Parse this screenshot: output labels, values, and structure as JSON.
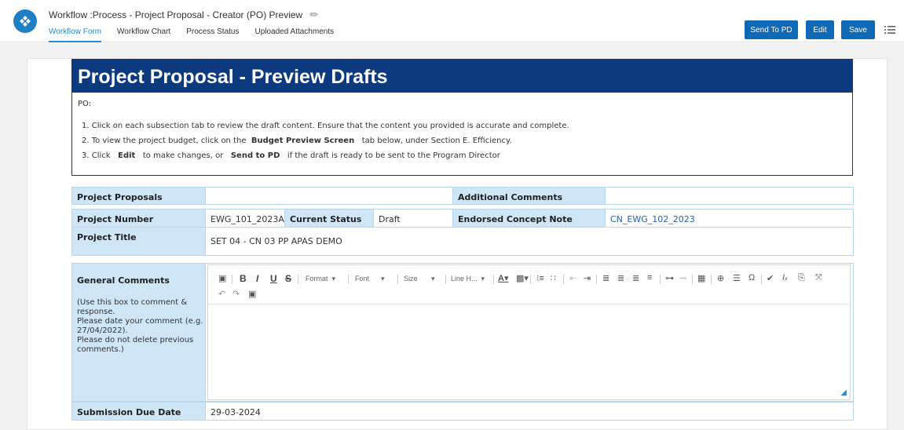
{
  "header": {
    "title": "Workflow :Process - Project Proposal - Creator (PO) Preview",
    "tabs": [
      {
        "label": "Workflow Form"
      },
      {
        "label": "Workflow Chart"
      },
      {
        "label": "Process Status"
      },
      {
        "label": "Uploaded Attachments"
      }
    ],
    "buttons": {
      "send_pd": "Send To PD",
      "edit": "Edit",
      "save": "Save"
    }
  },
  "banner": {
    "title": "Project Proposal - Preview Drafts"
  },
  "instructions": {
    "label": "PO:",
    "line1": "1. Click on each subsection tab to review the draft content.  Ensure that the content you provided is accurate and complete.",
    "line2_pre": "2. To view the project budget, click on the",
    "line2_bold": "Budget Preview Screen",
    "line2_post": "tab below, under Section E. Efficiency.",
    "line3_pre": "3. Click",
    "line3_bold1": "Edit",
    "line3_mid": "to make changes, or",
    "line3_bold2": "Send to PD",
    "line3_post": "if the draft is ready to be sent to the Program Director"
  },
  "form": {
    "project_proposals_label": "Project Proposals",
    "project_proposals_value": "",
    "additional_comments_label": "Additional Comments",
    "additional_comments_value": "",
    "project_number_label": "Project Number",
    "project_number_value": "EWG_101_2023A",
    "current_status_label": "Current Status",
    "current_status_value": "Draft",
    "endorsed_concept_note_label": "Endorsed Concept Note",
    "endorsed_concept_note_value": "CN_EWG_102_2023",
    "project_title_label": "Project Title",
    "project_title_value": "SET 04 - CN 03 PP APAS DEMO",
    "general_comments_label": "General Comments",
    "general_comments_help": "(Use this box to comment & response.\nPlease date your comment (e.g. 27/04/2022).\nPlease do not delete previous comments.)",
    "submission_due_date_label": "Submission Due Date",
    "submission_due_date_value": "29-03-2024"
  },
  "editor_toolbar": {
    "format": "Format",
    "font": "Font",
    "size": "Size",
    "line_height": "Line H..."
  },
  "colors": {
    "accent": "#1069b6",
    "banner": "#0d3a7f",
    "label_bg": "#cfe6f7",
    "link": "#1e63a6"
  }
}
